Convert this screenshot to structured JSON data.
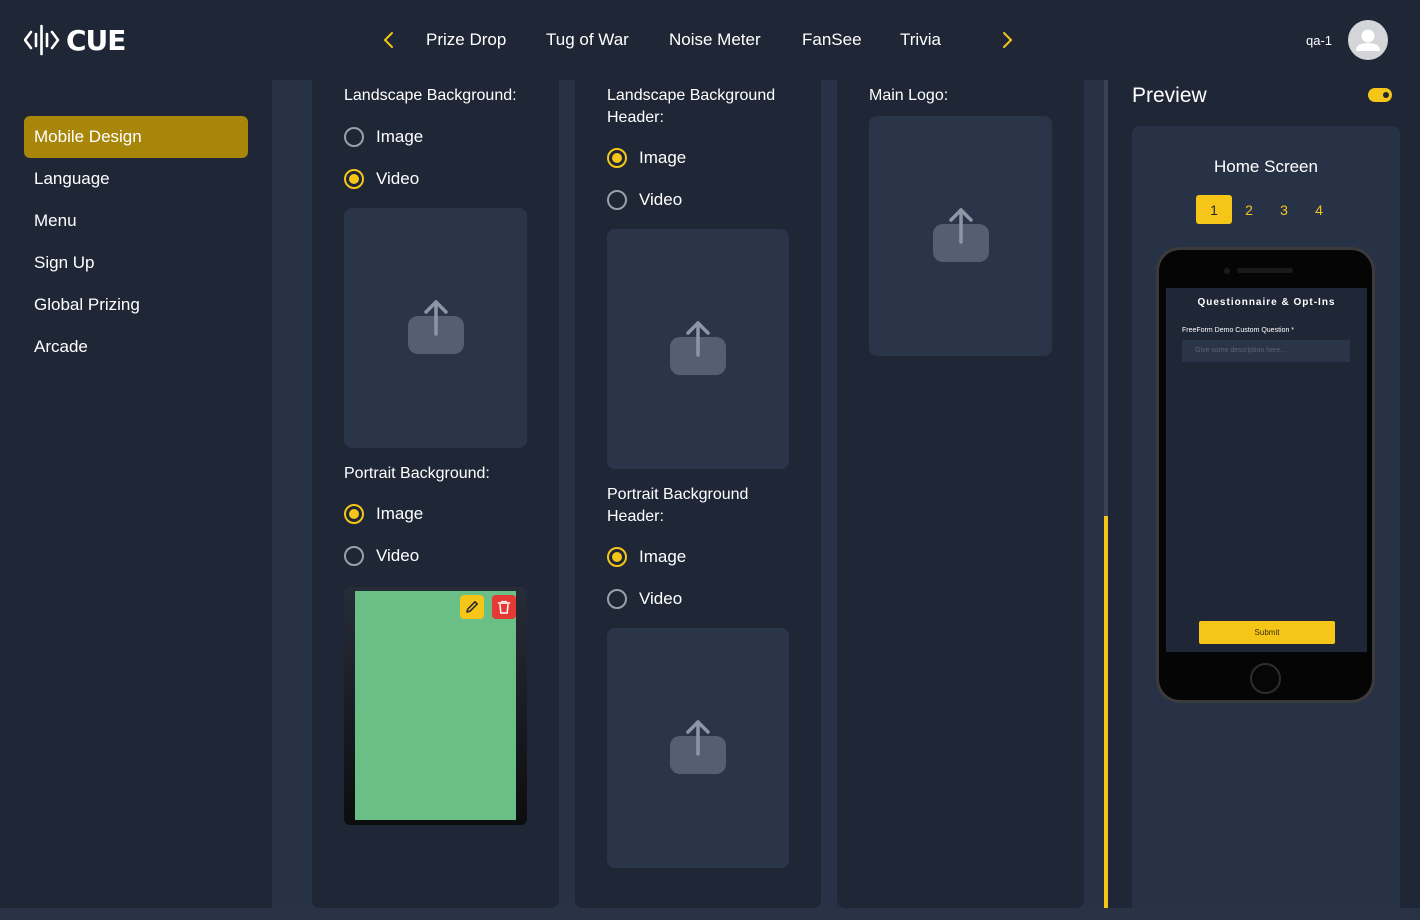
{
  "brand": {
    "logo_text": "CUE"
  },
  "nav": {
    "tabs": [
      "Prize Drop",
      "Tug of War",
      "Noise Meter",
      "FanSee",
      "Trivia"
    ],
    "accent": "#f5c518"
  },
  "user": {
    "name": "qa-1"
  },
  "sidebar": {
    "items": [
      {
        "label": "Mobile Design",
        "active": true
      },
      {
        "label": "Language"
      },
      {
        "label": "Menu"
      },
      {
        "label": "Sign Up"
      },
      {
        "label": "Global Prizing"
      },
      {
        "label": "Arcade"
      }
    ],
    "active_color": "#a8860a"
  },
  "columns": {
    "landscape_background": {
      "label": "Landscape Background:",
      "options": [
        "Image",
        "Video"
      ],
      "selected": "Video"
    },
    "portrait_background": {
      "label": "Portrait Background:",
      "options": [
        "Image",
        "Video"
      ],
      "selected": "Image"
    },
    "landscape_background_header": {
      "label_line1": "Landscape Background",
      "label_line2": "Header:",
      "options": [
        "Image",
        "Video"
      ],
      "selected": "Image"
    },
    "portrait_background_header": {
      "label_line1": "Portrait Background",
      "label_line2": "Header:",
      "options": [
        "Image",
        "Video"
      ],
      "selected": "Image"
    },
    "main_logo": {
      "label": "Main Logo:"
    }
  },
  "preview": {
    "title": "Preview",
    "enabled": true,
    "screen_label": "Home Screen",
    "pages": [
      "1",
      "2",
      "3",
      "4"
    ],
    "active_page": "1",
    "phone": {
      "title": "Questionnaire & Opt-Ins",
      "question": "FreeForm Demo Custom Question *",
      "input_placeholder": "Give some description here...",
      "submit_label": "Submit"
    }
  }
}
